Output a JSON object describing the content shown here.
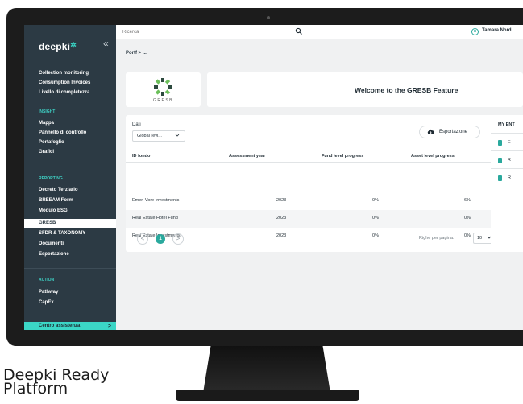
{
  "caption": "Deepki Ready Platform",
  "brand": {
    "logo": "deepki",
    "accent": "#3bd6c6",
    "sidebar_bg": "#2c3a44",
    "primary": "#2aa99d"
  },
  "sidebar": {
    "collapse_glyph": "«",
    "top_items": [
      {
        "label": "Collection monitoring"
      },
      {
        "label": "Consumption Invoices"
      },
      {
        "label": "Livello di completezza"
      }
    ],
    "sections": [
      {
        "title": "INSIGHT",
        "items": [
          {
            "label": "Mappa"
          },
          {
            "label": "Pannello di controllo"
          },
          {
            "label": "Portafoglio"
          },
          {
            "label": "Grafici"
          }
        ]
      },
      {
        "title": "REPORTING",
        "items": [
          {
            "label": "Decreto Terziario"
          },
          {
            "label": "BREEAM Form"
          },
          {
            "label": "Modulo ESG"
          },
          {
            "label": "GRESB",
            "active": true
          },
          {
            "label": "SFDR & TAXONOMY"
          },
          {
            "label": "Documenti"
          },
          {
            "label": "Esportazione"
          }
        ]
      },
      {
        "title": "ACTION",
        "items": [
          {
            "label": "Pathway"
          },
          {
            "label": "CapEx"
          }
        ]
      }
    ],
    "assist": {
      "label": "Centro assistenza",
      "arrow": ">"
    }
  },
  "topbar": {
    "search_placeholder": "Ricerca",
    "user_name": "Tamara Nord"
  },
  "breadcrumb": "Portf  >  ...",
  "welcome": {
    "logo_text": "GRESB",
    "title": "Welcome to the GRESB Feature"
  },
  "filters": {
    "dati_label": "Dati",
    "dati_value": "Global revi..."
  },
  "export_label": "Esportazione",
  "table": {
    "headers": [
      "ID fondo",
      "Assessment year",
      "Fund level progress",
      "Asset level progress"
    ],
    "rows": [
      {
        "fund": "Emen Vore Investments",
        "year": "2023",
        "fund_progress": "0%",
        "asset_progress": "6%"
      },
      {
        "fund": "Real Estate Hotel Fund",
        "year": "2023",
        "fund_progress": "0%",
        "asset_progress": "0%"
      },
      {
        "fund": "Real Estate Investments",
        "year": "2023",
        "fund_progress": "0%",
        "asset_progress": "0%"
      }
    ]
  },
  "pagination": {
    "prev": "<",
    "current": "1",
    "next": ">",
    "rows_per_page_label": "Righe per pagina:",
    "rows_per_page": "10"
  },
  "right_panel": {
    "title": "MY ENT",
    "items": [
      "E",
      "R",
      "R"
    ]
  }
}
